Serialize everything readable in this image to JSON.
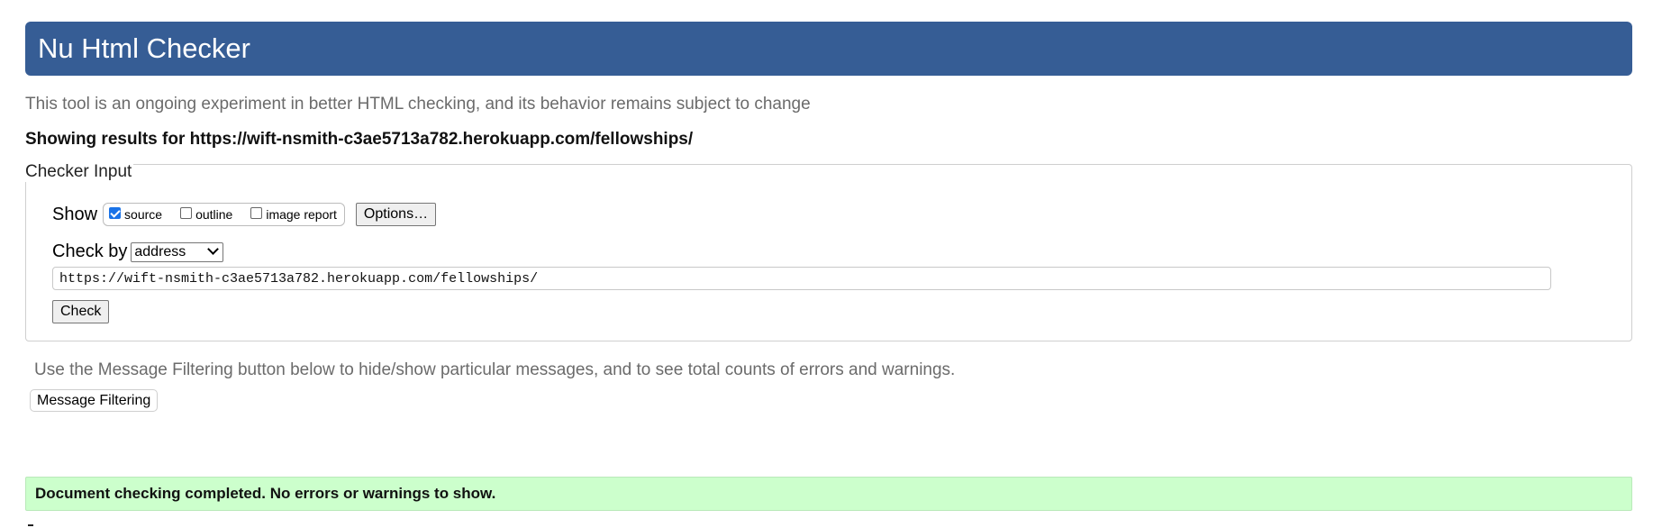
{
  "header": {
    "title": "Nu Html Checker"
  },
  "subtitle": "This tool is an ongoing experiment in better HTML checking, and its behavior remains subject to change",
  "results_line": "Showing results for https://wift-nsmith-c3ae5713a782.herokuapp.com/fellowships/",
  "checker_input": {
    "legend": "Checker Input",
    "show_label": "Show",
    "show_options": [
      {
        "label": "source",
        "checked": true
      },
      {
        "label": "outline",
        "checked": false
      },
      {
        "label": "image report",
        "checked": false
      }
    ],
    "options_button": "Options…",
    "check_by_label": "Check by",
    "check_by_value": "address",
    "url_value": "https://wift-nsmith-c3ae5713a782.herokuapp.com/fellowships/",
    "check_button": "Check"
  },
  "filter": {
    "hint": "Use the Message Filtering button below to hide/show particular messages, and to see total counts of errors and warnings.",
    "button": "Message Filtering"
  },
  "status_message": "Document checking completed. No errors or warnings to show.",
  "colors": {
    "header_bg": "#365d95",
    "success_bg": "#ccffcc",
    "checkbox_checked": "#1a73e8"
  }
}
